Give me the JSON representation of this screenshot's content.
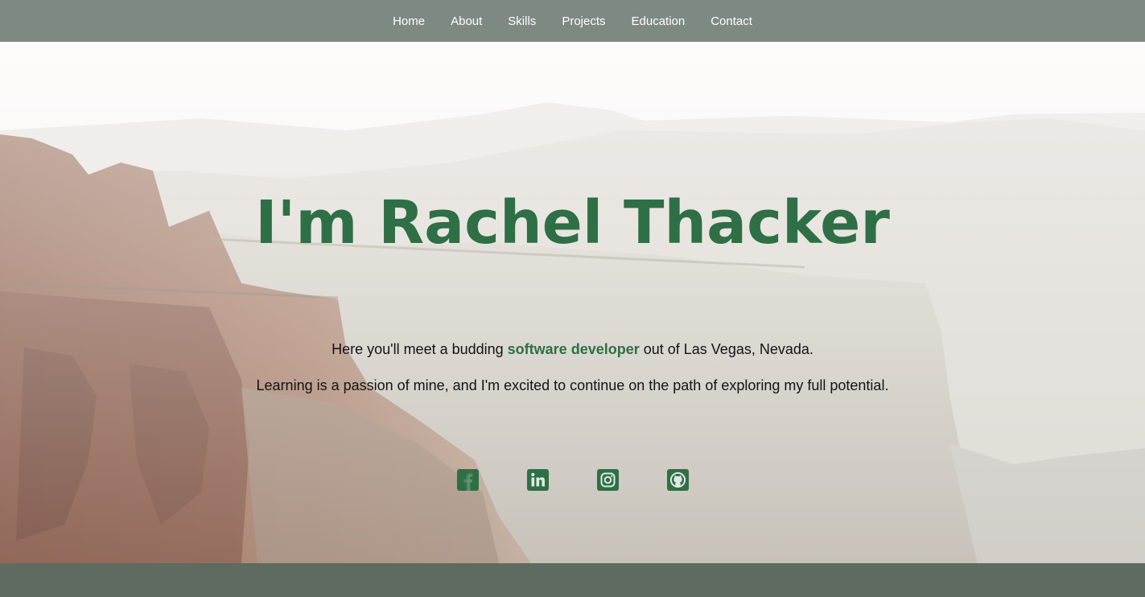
{
  "nav": {
    "items": [
      {
        "label": "Home"
      },
      {
        "label": "About"
      },
      {
        "label": "Skills"
      },
      {
        "label": "Projects"
      },
      {
        "label": "Education"
      },
      {
        "label": "Contact"
      }
    ]
  },
  "hero": {
    "title": "I'm Rachel Thacker",
    "line1_pre": "Here you'll meet a budding ",
    "line1_highlight": "software developer",
    "line1_post": " out of Las Vegas, Nevada.",
    "line2": "Learning is a passion of mine, and I'm excited to continue on the path of exploring my full potential."
  },
  "socials": [
    {
      "icon": "facebook-icon"
    },
    {
      "icon": "linkedin-icon"
    },
    {
      "icon": "instagram-icon"
    },
    {
      "icon": "github-icon"
    }
  ],
  "colors": {
    "accent": "#2e6f45",
    "nav_bg": "#7e8a81",
    "footer_bg": "#5d6b60"
  }
}
